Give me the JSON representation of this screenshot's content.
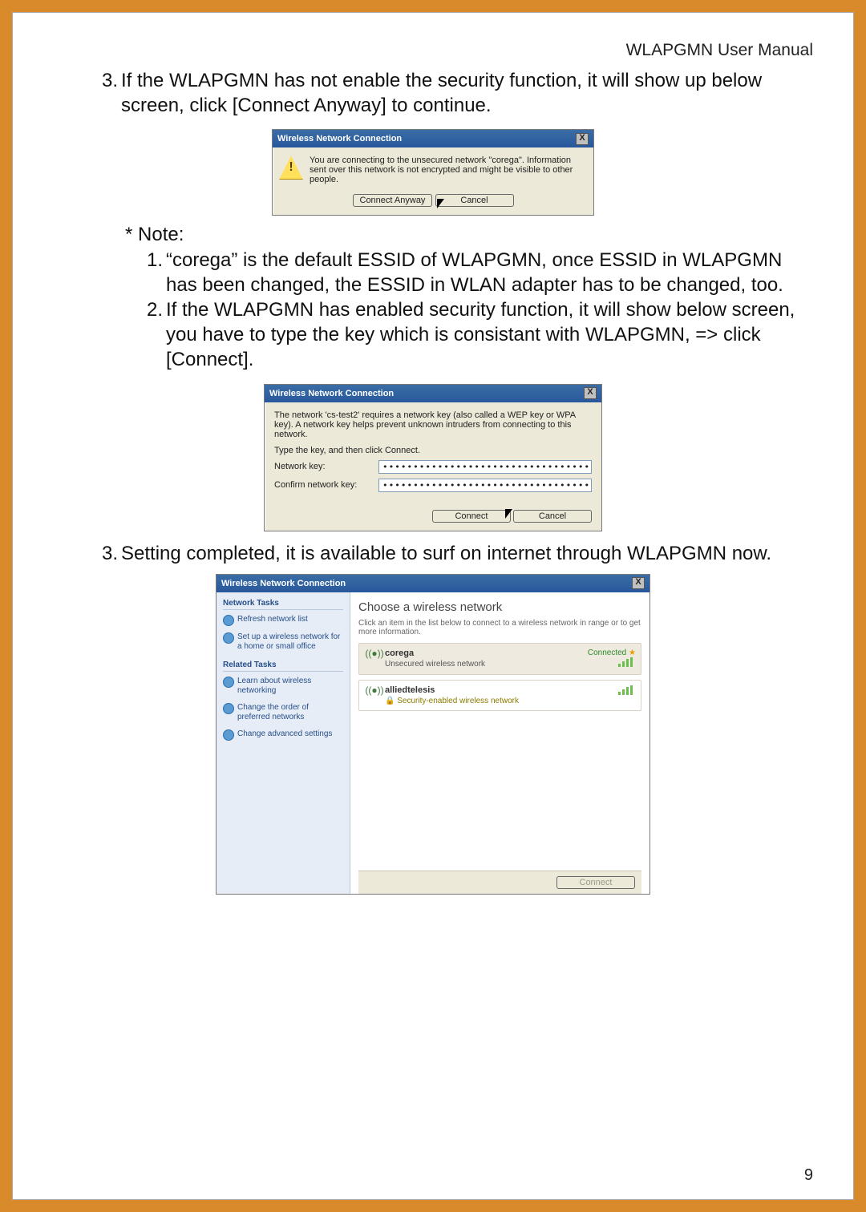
{
  "header": {
    "title": "WLAPGMN User Manual"
  },
  "page_number": "9",
  "para1": {
    "num": "3.",
    "text": "If the WLAPGMN has not enable the security function, it will show up below screen, click [Connect Anyway] to continue."
  },
  "dialog1": {
    "title": "Wireless Network Connection",
    "close": "X",
    "message": "You are connecting to the unsecured network \"corega\". Information sent over this network is not encrypted and might be visible to other people.",
    "buttons": {
      "connect_anyway": "Connect Anyway",
      "cancel": "Cancel"
    }
  },
  "note_label": "* Note:",
  "note1": {
    "num": "1.",
    "text": "“corega” is the default ESSID of WLAPGMN, once ESSID in WLAPGMN has been changed, the ESSID in WLAN adapter has to be changed, too."
  },
  "note2": {
    "num": "2.",
    "text": "If the WLAPGMN has enabled security function, it will show below screen, you have to type the key which is consistant with WLAPGMN, => click [Connect]."
  },
  "dialog2": {
    "title": "Wireless Network Connection",
    "close": "X",
    "message": "The network 'cs-test2' requires a network key (also called a WEP key or WPA key). A network key helps prevent unknown intruders from connecting to this network.",
    "instruction": "Type the key, and then click Connect.",
    "key_label": "Network key:",
    "confirm_label": "Confirm network key:",
    "key_value": "•••••••••••••••••••••••••••••••••••••",
    "confirm_value": "•••••••••••••••••••••••••••••••••••••",
    "buttons": {
      "connect": "Connect",
      "cancel": "Cancel"
    }
  },
  "para3": {
    "num": "3.",
    "text": "Setting completed, it is available to surf on internet through WLAPGMN now."
  },
  "dialog3": {
    "title": "Wireless Network Connection",
    "close": "X",
    "side": {
      "tasks_hd": "Network Tasks",
      "task_refresh": "Refresh network list",
      "task_setup": "Set up a wireless network for a home or small office",
      "related_hd": "Related Tasks",
      "task_learn": "Learn about wireless networking",
      "task_order": "Change the order of preferred networks",
      "task_adv": "Change advanced settings"
    },
    "main": {
      "heading": "Choose a wireless network",
      "sub": "Click an item in the list below to connect to a wireless network in range or to get more information.",
      "networks": [
        {
          "name": "corega",
          "type": "Unsecured wireless network",
          "status": "Connected",
          "secure": false,
          "selected": true
        },
        {
          "name": "alliedtelesis",
          "type": "Security-enabled wireless network",
          "status": "",
          "secure": true,
          "selected": false
        }
      ],
      "connect_btn": "Connect"
    }
  }
}
